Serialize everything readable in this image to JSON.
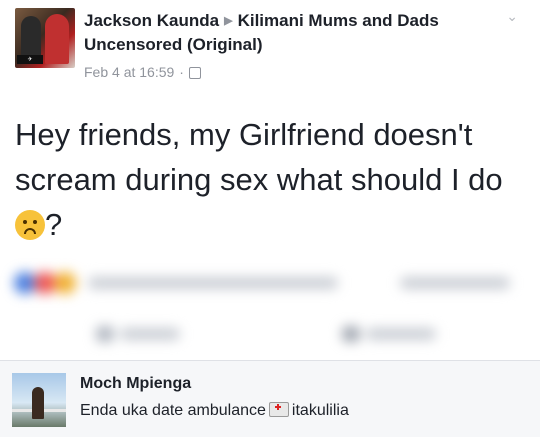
{
  "post": {
    "author": "Jackson Kaunda",
    "group": "Kilimani Mums and Dads Uncensored (Original)",
    "date": "Feb 4 at 16:59",
    "separator": "·",
    "text_before_emoji": "Hey friends, my Girlfriend doesn't scream during sex what should I do",
    "text_after_emoji": "?"
  },
  "comment": {
    "author": "Moch Mpienga",
    "text_before": "Enda uka date ambulance",
    "text_after": "itakulilia"
  }
}
